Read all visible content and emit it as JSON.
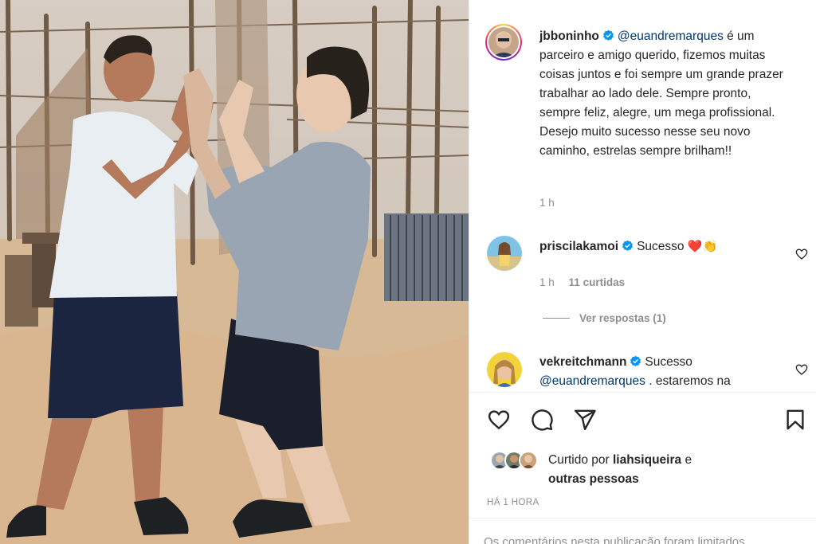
{
  "post": {
    "author": "jbboninho",
    "caption_mention": "@euandremarques",
    "caption_text": " é um parceiro e amigo querido, fizemos muitas coisas juntos e foi sempre um grande prazer trabalhar ao lado dele. Sempre pronto, sempre feliz, alegre, um mega profissional. Desejo muito sucesso nesse seu novo caminho, estrelas sempre brilham!!",
    "caption_time": "1 h"
  },
  "comments": [
    {
      "username": "priscilakamoi",
      "text": "Sucesso",
      "emoji": "❤️👏",
      "time": "1 h",
      "likes": "11 curtidas"
    },
    {
      "username": "vekreitchmann",
      "text": "Sucesso",
      "mention": "@euandremarques",
      "text_after": " . estaremos na"
    }
  ],
  "replies_label": "Ver respostas (1)",
  "actions": {
    "like_icon": "heart-icon",
    "comment_icon": "comment-icon",
    "share_icon": "paper-plane-icon",
    "save_icon": "bookmark-icon"
  },
  "liked_by": {
    "prefix": "Curtido por ",
    "user": "liahsiqueira",
    "suffix": " e",
    "others": "outras pessoas"
  },
  "post_time": "HÁ 1 HORA",
  "footer_note": "Os comentários nesta publicação foram limitados",
  "colors": {
    "mention": "#00376b",
    "verified": "#0095f6",
    "secondary": "#8e8e8e",
    "heart_red": "#e0245e"
  }
}
